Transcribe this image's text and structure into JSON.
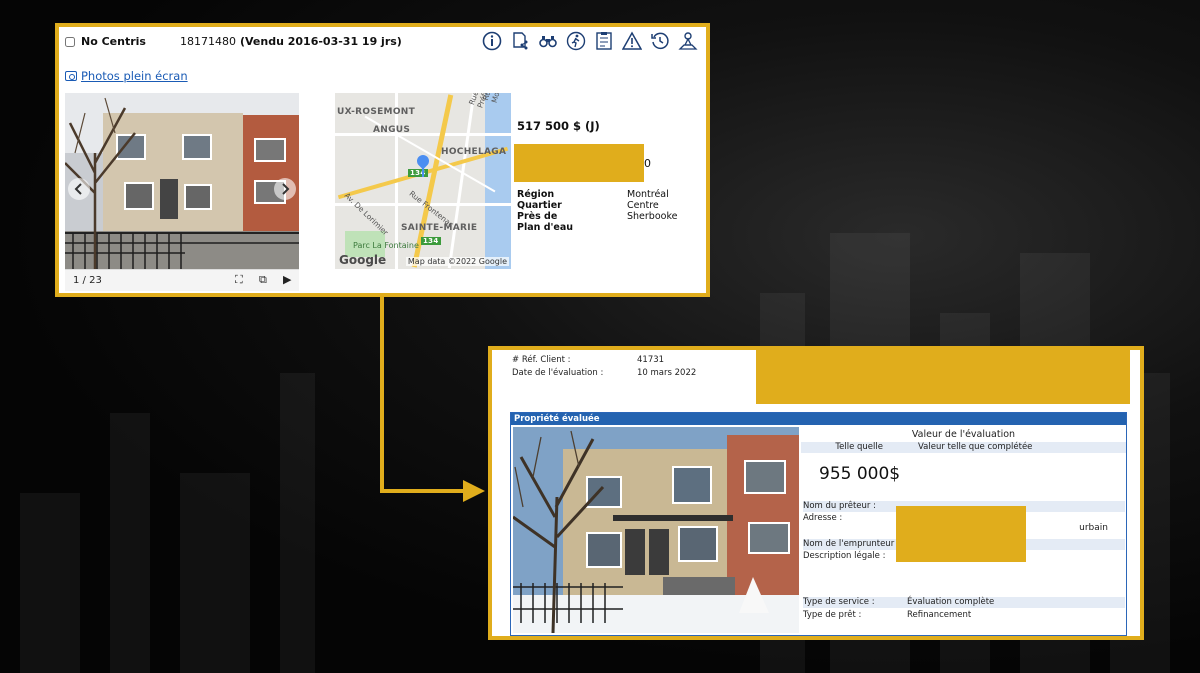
{
  "listing": {
    "no_centris_label": "No Centris",
    "mls_number": "18171480",
    "sold_status": "(Vendu 2016-03-31 19 jrs)",
    "photos_link": "Photos plein écran",
    "photo_counter": "1 / 23",
    "price": "517 500 $ (J)",
    "price_tail": "0",
    "info": [
      {
        "key": "Région",
        "value": "Montréal"
      },
      {
        "key": "Quartier",
        "value": "Centre"
      },
      {
        "key": "Près de",
        "value": "Sherbooke"
      },
      {
        "key": "Plan d'eau",
        "value": ""
      }
    ],
    "toolbar_icons": [
      "info-icon",
      "document-share-icon",
      "binoculars-icon",
      "walking-person-icon",
      "checklist-icon",
      "warning-icon",
      "history-clock-icon",
      "map-person-icon"
    ]
  },
  "map": {
    "labels": [
      "UX-ROSEMONT",
      "ANGUS",
      "HOCHELAGA",
      "SAINTE-MARIE"
    ],
    "streets": [
      "Rue Frontenac",
      "Av. De Lorimier",
      "Rue Préfontaine",
      "Rue Moreau"
    ],
    "route_labels": [
      "134",
      "134"
    ],
    "park_label": "Parc La Fontaine",
    "google_logo": "Google",
    "attribution": "Map data ©2022 Google"
  },
  "evaluation": {
    "meta": [
      {
        "key": "# Réf. Client :",
        "value": "41731"
      },
      {
        "key": "Date de l'évaluation :",
        "value": "10 mars 2022"
      }
    ],
    "section_title": "Propriété évaluée",
    "value_title": "Valeur de l'évaluation",
    "col_as_is": "Telle quelle",
    "col_completed": "Valeur telle que complétée",
    "value": "955 000$",
    "rows": [
      {
        "key": "Nom du prêteur :",
        "value": ""
      },
      {
        "key": "Adresse :",
        "value": ""
      },
      {
        "key": "Nom de l'emprunteur :",
        "value": ""
      },
      {
        "key": "Description légale :",
        "value": ""
      },
      {
        "key": "Type de service :",
        "value": "Évaluation complète"
      },
      {
        "key": "Type de prêt :",
        "value": "Refinancement"
      }
    ],
    "address_tail": "urbain"
  },
  "colors": {
    "accent": "#e0ad1c",
    "section_blue": "#2463b0",
    "link": "#1a5bb5"
  }
}
